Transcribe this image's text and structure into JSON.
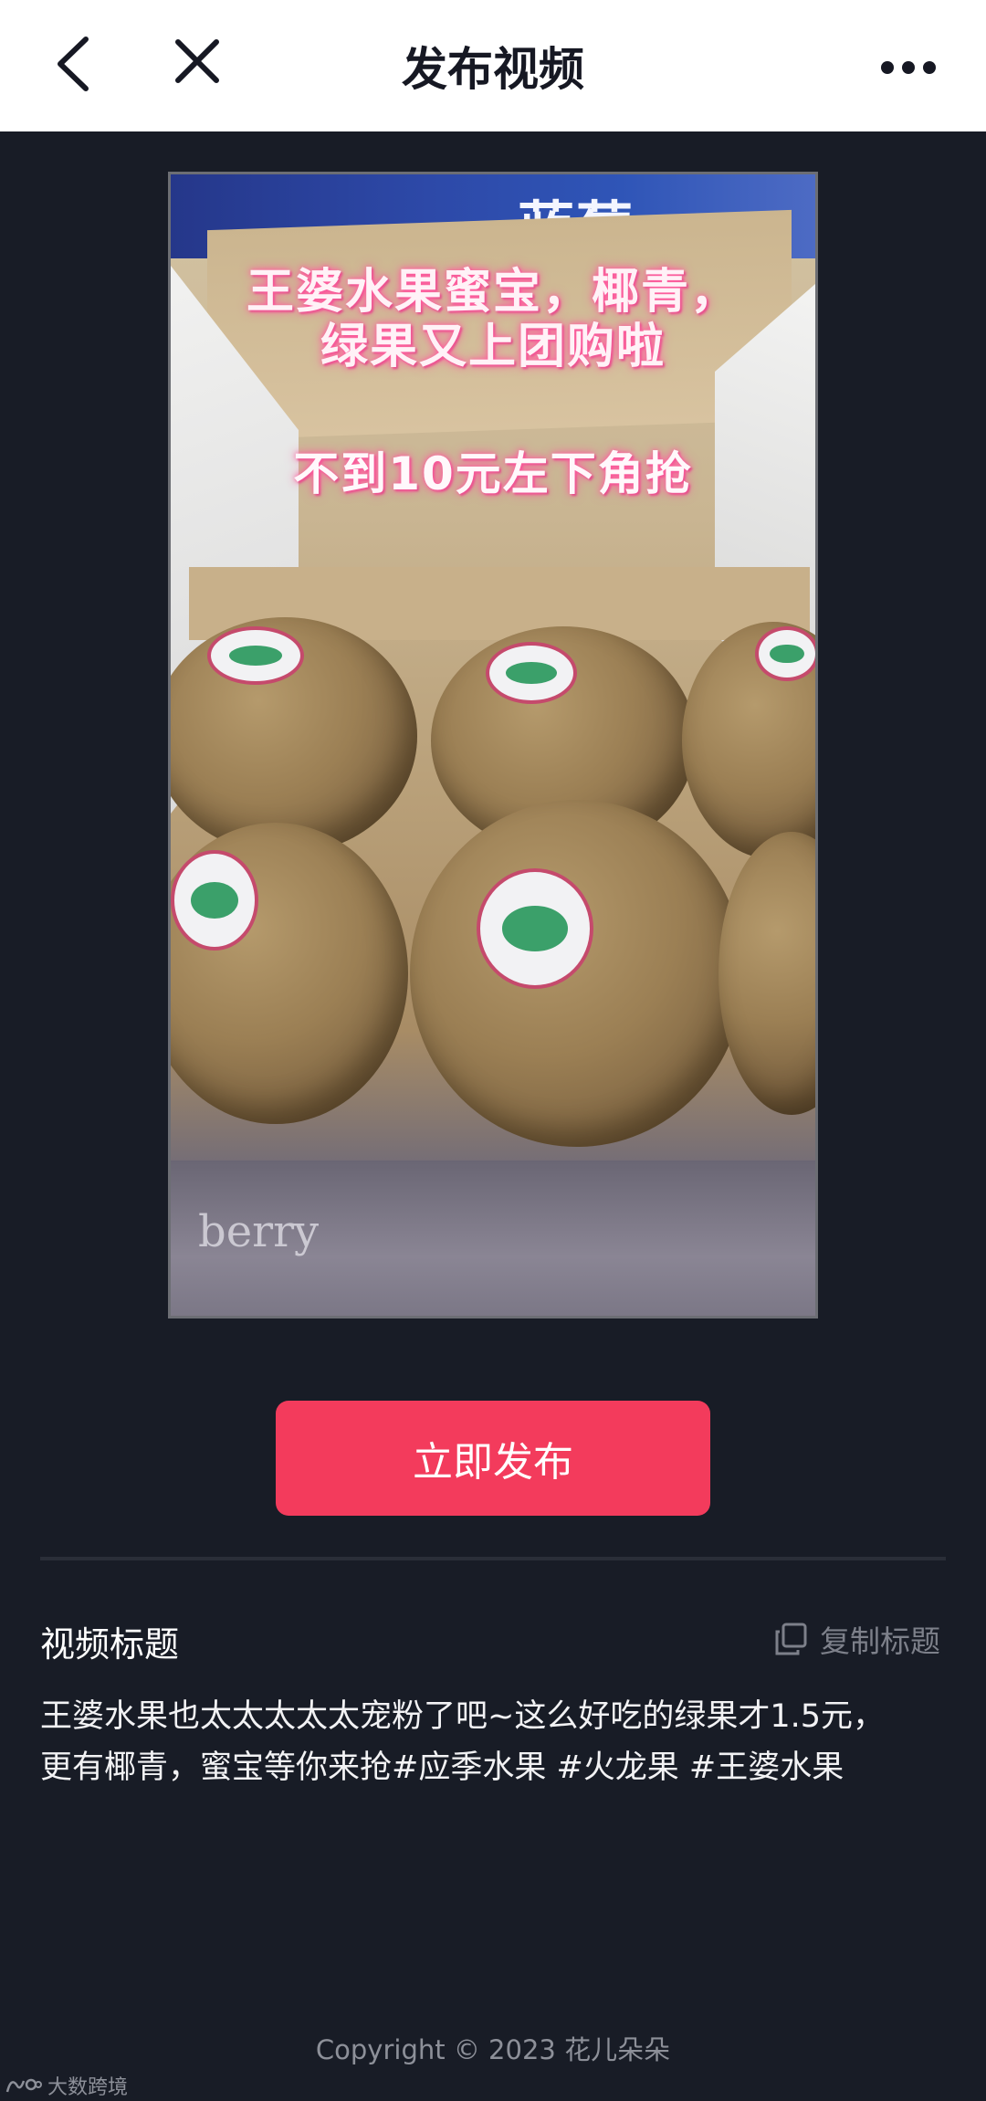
{
  "header": {
    "title": "发布视频",
    "back_icon": "chevron-left-icon",
    "close_icon": "close-icon",
    "more_icon": "more-horizontal-icon"
  },
  "video": {
    "overlay_line1": "王婆水果蜜宝，椰青，",
    "overlay_line2": "绿果又上团购啦",
    "overlay_line3": "不到10元左下角抢",
    "brand_text": "蓝莓",
    "bottom_text": "berry"
  },
  "actions": {
    "publish_label": "立即发布"
  },
  "title_section": {
    "label": "视频标题",
    "copy_label": "复制标题",
    "copy_icon": "copy-icon",
    "caption_line1": "王婆水果也太太太太太宠粉了吧~这么好吃的绿果才1.5元，",
    "caption_line2": "更有椰青，蜜宝等你来抢#应季水果 #火龙果 #王婆水果"
  },
  "footer": {
    "copyright": "Copyright © 2023 花儿朵朵"
  },
  "watermark": {
    "text": "大数跨境"
  },
  "colors": {
    "accent": "#f33b5c",
    "background": "#181c26",
    "header_bg": "#ffffff",
    "muted_text": "#7d808a"
  }
}
